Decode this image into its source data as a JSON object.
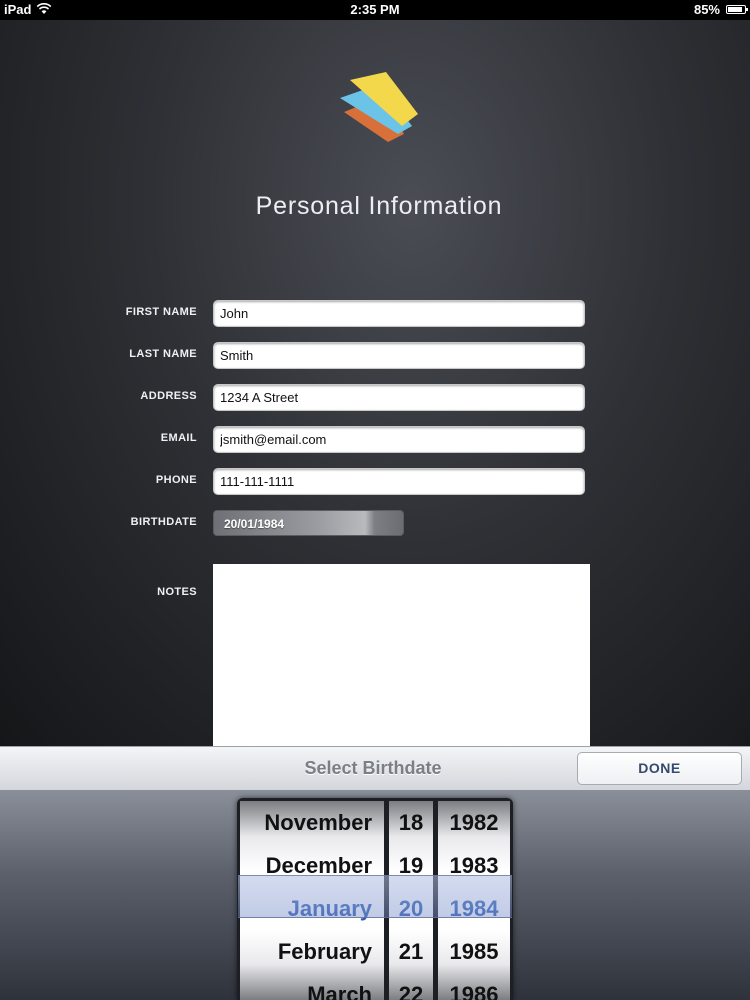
{
  "status_bar": {
    "device": "iPad",
    "time": "2:35 PM",
    "battery": "85%",
    "battery_level": 0.85
  },
  "header": {
    "title": "Personal Information"
  },
  "form": {
    "first_name": {
      "label": "FIRST NAME",
      "value": "John"
    },
    "last_name": {
      "label": "LAST NAME",
      "value": "Smith"
    },
    "address": {
      "label": "ADDRESS",
      "value": "1234 A Street"
    },
    "email": {
      "label": "EMAIL",
      "value": "jsmith@email.com"
    },
    "phone": {
      "label": "PHONE",
      "value": "111-111-1111"
    },
    "birthdate": {
      "label": "BIRTHDATE",
      "value": "20/01/1984"
    },
    "notes": {
      "label": "NOTES",
      "value": ""
    }
  },
  "picker": {
    "title": "Select Birthdate",
    "done_label": "DONE",
    "months": [
      "November",
      "December",
      "January",
      "February",
      "March"
    ],
    "days": [
      "18",
      "19",
      "20",
      "21",
      "22"
    ],
    "years": [
      "1982",
      "1983",
      "1984",
      "1985",
      "1986"
    ],
    "selected": {
      "month": "January",
      "day": "20",
      "year": "1984"
    }
  },
  "colors": {
    "accent": "#2f5fb3",
    "logo_yellow": "#f2d84a",
    "logo_blue": "#6cc3e8",
    "logo_orange": "#d8703a"
  }
}
